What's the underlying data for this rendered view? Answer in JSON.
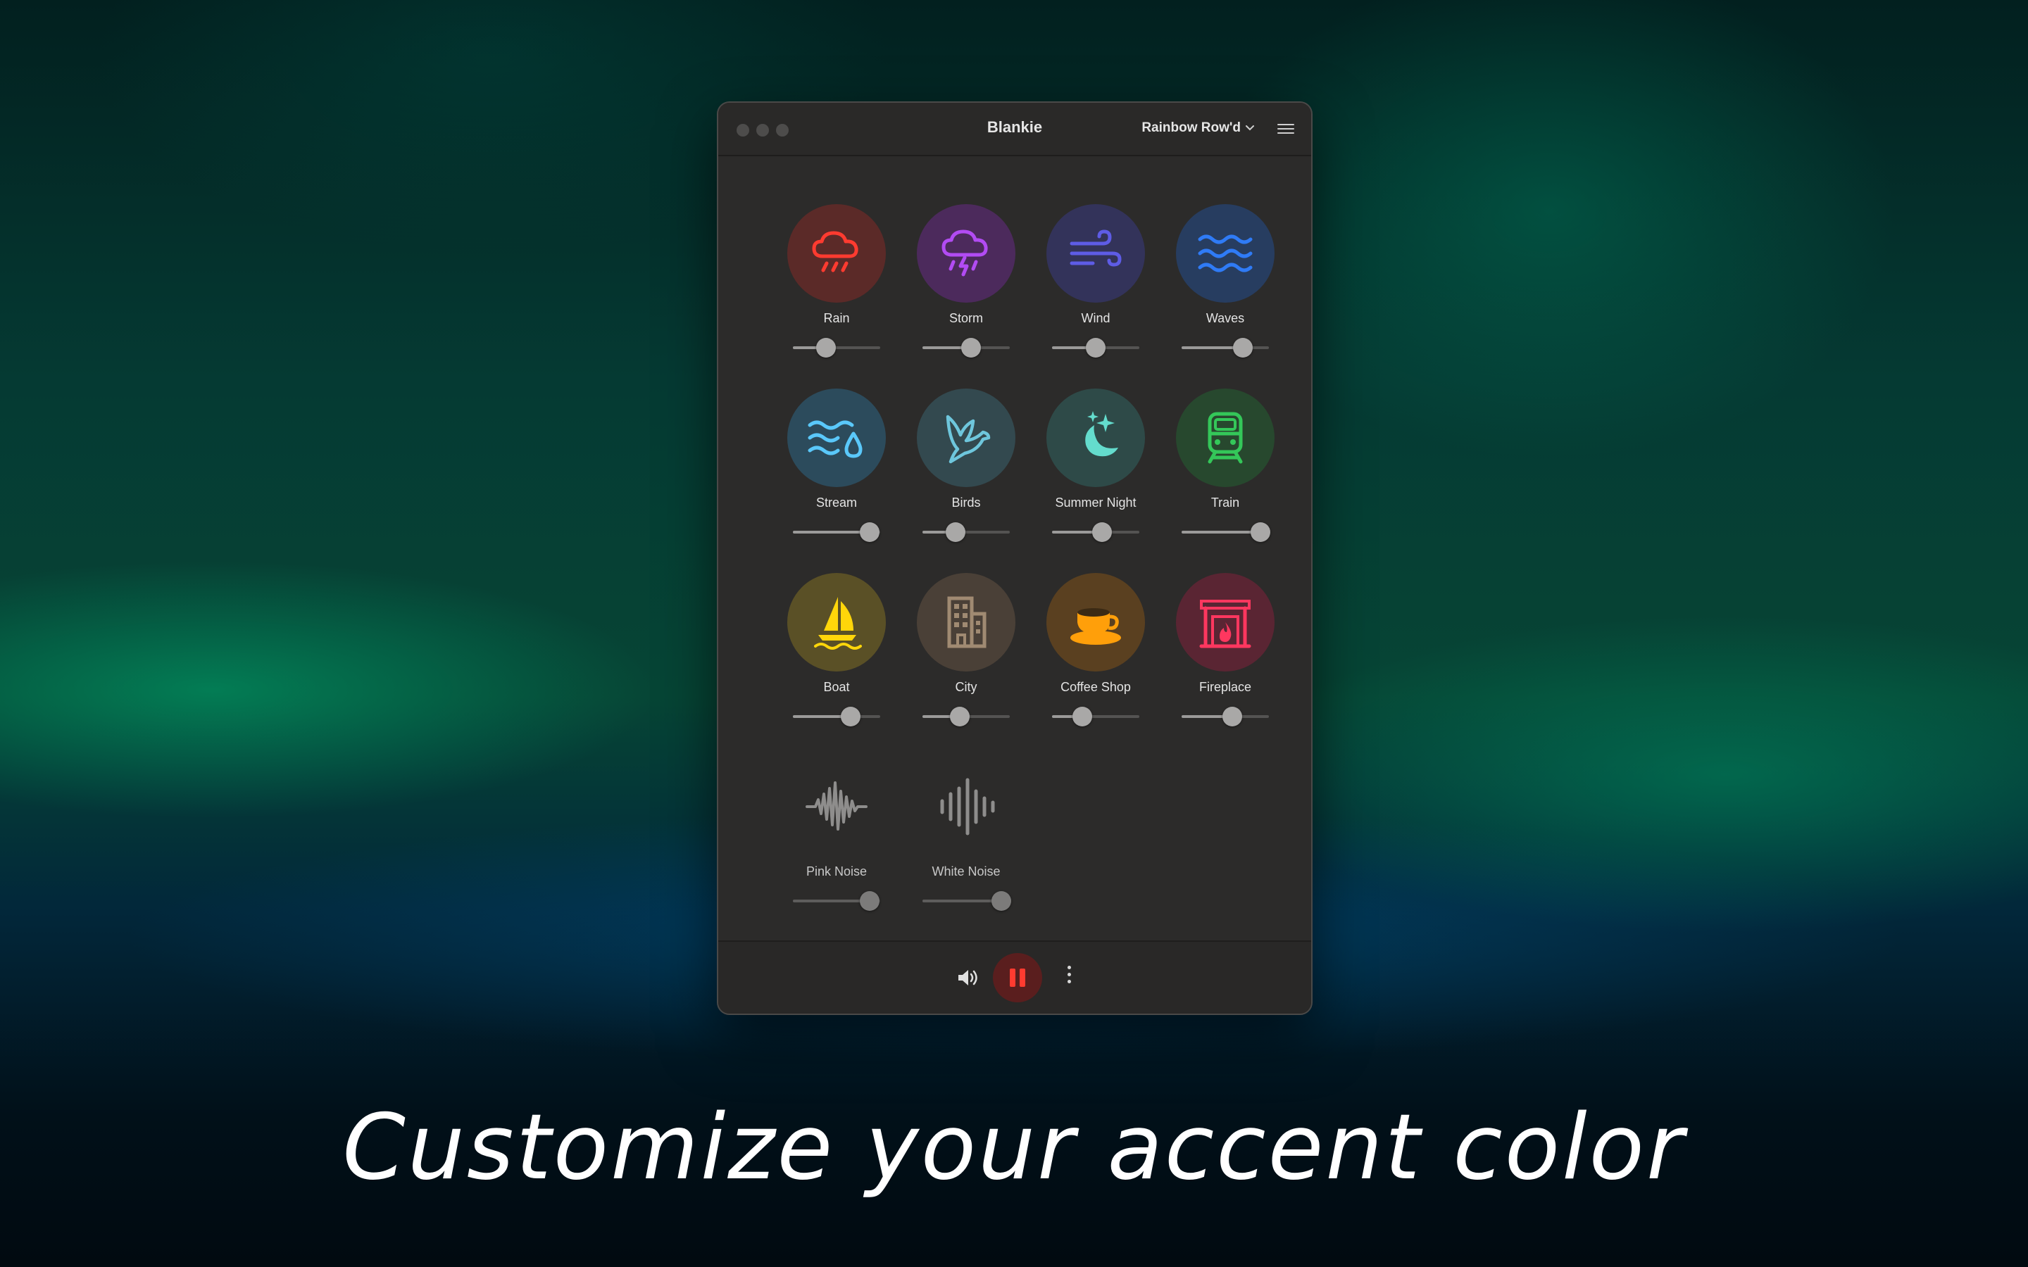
{
  "window": {
    "title": "Blankie",
    "preset": "Rainbow Row'd"
  },
  "sounds": [
    {
      "label": "Rain",
      "icon": "rain-cloud-icon",
      "color": "#ff3b30",
      "bg": "#5b2a28",
      "volume": 0.38
    },
    {
      "label": "Storm",
      "icon": "storm-cloud-icon",
      "color": "#b24bf3",
      "bg": "#4c2a5c",
      "volume": 0.56
    },
    {
      "label": "Wind",
      "icon": "wind-icon",
      "color": "#5e5ce6",
      "bg": "#33335a",
      "volume": 0.5
    },
    {
      "label": "Waves",
      "icon": "waves-icon",
      "color": "#2f7bf6",
      "bg": "#273d60",
      "volume": 0.7
    },
    {
      "label": "Stream",
      "icon": "stream-drop-icon",
      "color": "#5ac8fa",
      "bg": "#2c4b5c",
      "volume": 0.88
    },
    {
      "label": "Birds",
      "icon": "bird-icon",
      "color": "#6ec6dc",
      "bg": "#33494f",
      "volume": 0.38
    },
    {
      "label": "Summer Night",
      "icon": "moon-stars-icon",
      "color": "#64dccd",
      "bg": "#2e4a48",
      "volume": 0.57
    },
    {
      "label": "Train",
      "icon": "train-icon",
      "color": "#34c759",
      "bg": "#27482e",
      "volume": 0.9
    },
    {
      "label": "Boat",
      "icon": "sailboat-icon",
      "color": "#ffd60a",
      "bg": "#5a5026",
      "volume": 0.66
    },
    {
      "label": "City",
      "icon": "building-icon",
      "color": "#a08a72",
      "bg": "#4a4037",
      "volume": 0.43
    },
    {
      "label": "Coffee Shop",
      "icon": "coffee-cup-icon",
      "color": "#ff9f0a",
      "bg": "#5a4020",
      "volume": 0.35
    },
    {
      "label": "Fireplace",
      "icon": "fireplace-icon",
      "color": "#ff375f",
      "bg": "#5a2533",
      "volume": 0.58
    },
    {
      "label": "Pink Noise",
      "icon": "pink-noise-waveform-icon",
      "color": "#8e8d8c",
      "bg": "transparent",
      "volume": 0.88
    },
    {
      "label": "White Noise",
      "icon": "white-noise-waveform-icon",
      "color": "#8e8d8c",
      "bg": "transparent",
      "volume": 0.9
    }
  ],
  "controls": {
    "volume_icon": "speaker-icon",
    "play_icon": "pause-icon",
    "more_icon": "more-vertical-icon",
    "accent": "#ff3b30"
  },
  "caption": "Customize your accent color"
}
